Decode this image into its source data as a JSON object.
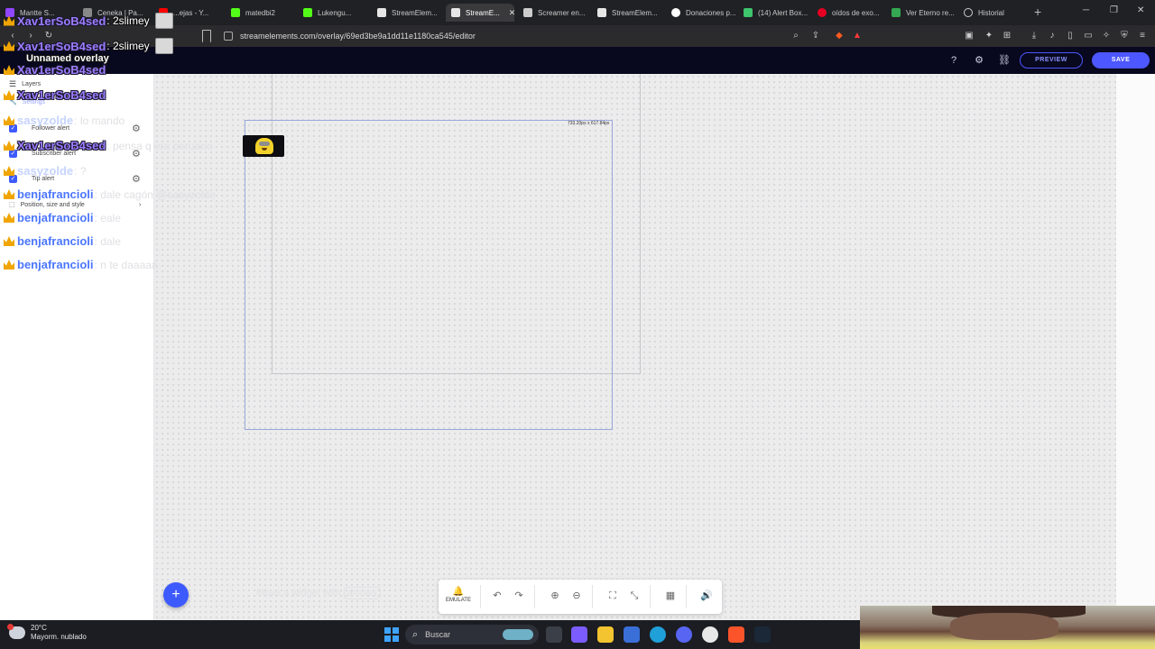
{
  "browser": {
    "tabs": [
      {
        "label": "Mantte S...",
        "color": "#9146ff"
      },
      {
        "label": "Ceneka | Pa...",
        "color": "#888888"
      },
      {
        "label": "...ejas - Y...",
        "color": "#ff0000"
      },
      {
        "label": "matedbi2",
        "color": "#53fc18"
      },
      {
        "label": "Lukengu...",
        "color": "#53fc18"
      },
      {
        "label": "StreamElem...",
        "color": "#e6e6e6"
      },
      {
        "label": "StreamE...",
        "color": "#e6e6e6"
      },
      {
        "label": "Screamer en...",
        "color": "#cccccc"
      },
      {
        "label": "StreamElem...",
        "color": "#e6e6e6"
      },
      {
        "label": "Donaciones p...",
        "color": "#ffffff"
      },
      {
        "label": "(14) Alert Box...",
        "color": "#3ec46d"
      },
      {
        "label": "oídos de exo...",
        "color": "#e60023"
      },
      {
        "label": "Ver Eterno re...",
        "color": "#34a853"
      },
      {
        "label": "Historial",
        "color": "#cccccc"
      }
    ],
    "url": "streamelements.com/overlay/69ed3be9a1dd11e1180ca545/editor"
  },
  "editor": {
    "overlay_name": "Unnamed overlay",
    "preview_label": "PREVIEW",
    "save_label": "SAVE",
    "sidebar": {
      "layers_label": "Layers",
      "settings_label": "Settings",
      "alerts": [
        {
          "label": "Follower alert"
        },
        {
          "label": "Subscriber alert"
        },
        {
          "label": "Tip alert"
        }
      ],
      "position_label": "Position, size and style"
    },
    "canvas": {
      "size_label": "733.20px x 617.84px"
    },
    "hint": {
      "text": "Move a widget with",
      "key": "arrows"
    },
    "toolbar": {
      "emulate_label": "EMULATE"
    }
  },
  "chat": [
    {
      "user": "Xav1erSoB4sed",
      "msg": ": 2slimey",
      "style": "purple",
      "emote": true
    },
    {
      "user": "Xav1erSoB4sed",
      "msg": ": 2slimey",
      "style": "purple",
      "emote": true
    },
    {
      "user": "Xav1erSoB4sed",
      "msg": "",
      "style": "purple",
      "emote": false
    },
    {
      "user": "Xav1erSoB4sed",
      "msg": "",
      "style": "purple",
      "emote": false
    },
    {
      "user": "sasyzolde",
      "msg": ": lo mando",
      "style": "faded",
      "emote": false
    },
    {
      "user": "Xav1erSoB4sed",
      "msg": ": pensa q era peruano",
      "style": "purple",
      "emote": false
    },
    {
      "user": "sasyzolde",
      "msg": ": ?",
      "style": "faded",
      "emote": false
    },
    {
      "user": "benjafrancioli",
      "msg": ": dale cagón @sasyzolde",
      "style": "blue",
      "emote": false
    },
    {
      "user": "benjafrancioli",
      "msg": ": eale",
      "style": "blue",
      "emote": false
    },
    {
      "user": "benjafrancioli",
      "msg": ": dale",
      "style": "blue",
      "emote": false
    },
    {
      "user": "benjafrancioli",
      "msg": ": n te daaaaa",
      "style": "blue",
      "emote": false
    }
  ],
  "taskbar": {
    "temperature": "20°C",
    "weather": "Mayorm. nublado",
    "search_placeholder": "Buscar"
  }
}
